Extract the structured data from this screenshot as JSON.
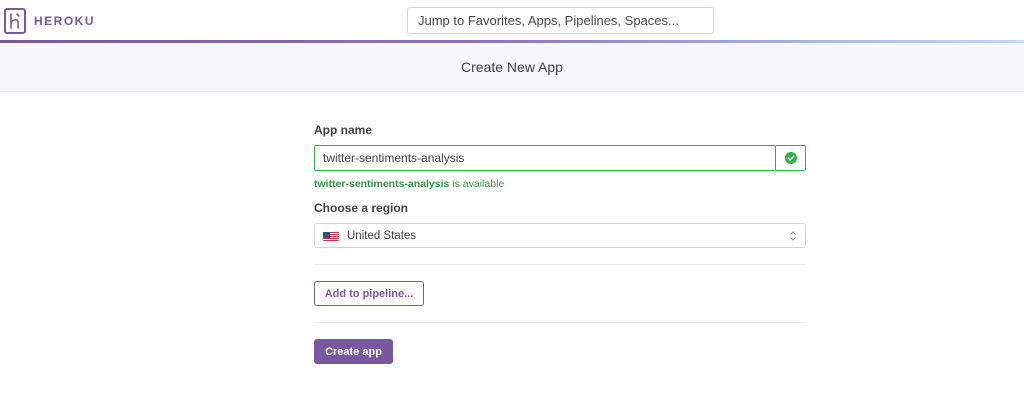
{
  "brand": {
    "logo_icon": "heroku-logo-icon",
    "name": "HEROKU",
    "color": "#79589f"
  },
  "search": {
    "placeholder": "Jump to Favorites, Apps, Pipelines, Spaces..."
  },
  "page": {
    "title": "Create New App"
  },
  "form": {
    "app_name_label": "App name",
    "app_name_value": "twitter-sentiments-analysis",
    "valid_icon": "check-circle-icon",
    "availability_name": "twitter-sentiments-analysis",
    "availability_suffix": " is available",
    "success_color": "#2fb243",
    "region_label": "Choose a region",
    "region_flag_icon": "us-flag-icon",
    "region_value": "United States",
    "pipeline_button": "Add to pipeline...",
    "create_button": "Create app"
  }
}
